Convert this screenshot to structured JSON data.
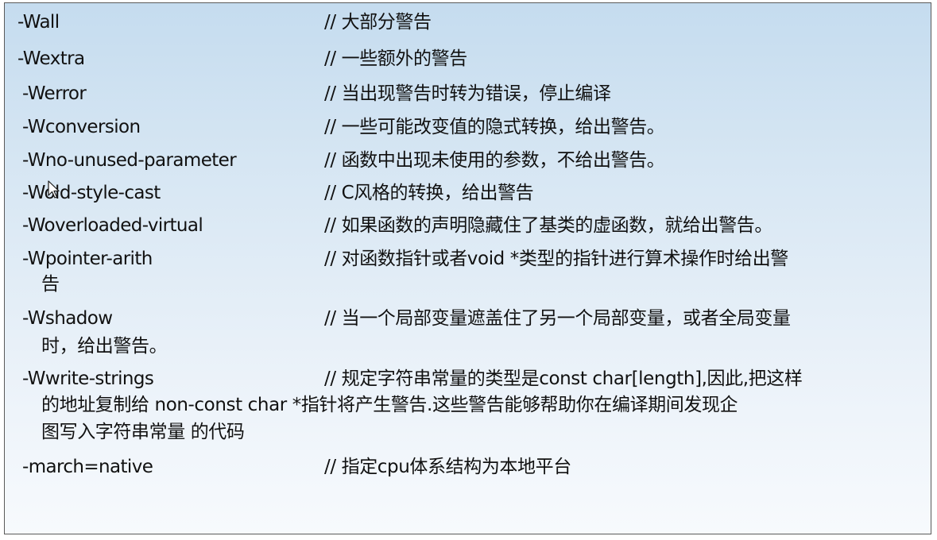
{
  "lines": [
    {
      "option": "-Wall",
      "desc": "// 大部分警告"
    },
    {
      "option": "-Wextra",
      "desc": "// 一些额外的警告"
    },
    {
      "option": "-Werror",
      "desc": "// 当出现警告时转为错误，停止编译"
    },
    {
      "option": "-Wconversion",
      "desc": "// 一些可能改变值的隐式转换，给出警告。"
    },
    {
      "option": "-Wno-unused-parameter",
      "desc": "// 函数中出现未使用的参数，不给出警告。"
    },
    {
      "option": "-Wold-style-cast",
      "desc": "// C风格的转换，给出警告"
    },
    {
      "option": "-Woverloaded-virtual",
      "desc": "// 如果函数的声明隐藏住了基类的虚函数，就给出警告。"
    },
    {
      "option": "-Wpointer-arith",
      "desc": "// 对函数指针或者void *类型的指针进行算术操作时给出警",
      "cont": [
        "告"
      ]
    },
    {
      "option": "-Wshadow",
      "desc": "// 当一个局部变量遮盖住了另一个局部变量，或者全局变量",
      "cont": [
        "时，给出警告。"
      ]
    },
    {
      "option": "-Wwrite-strings",
      "desc": "// 规定字符串常量的类型是const char[length],因此,把这样",
      "cont": [
        "的地址复制给 non-const char *指针将产生警告.这些警告能够帮助你在编译期间发现企",
        "图写入字符串常量 的代码"
      ]
    },
    {
      "option": "-march=native",
      "desc": "// 指定cpu体系结构为本地平台"
    }
  ]
}
